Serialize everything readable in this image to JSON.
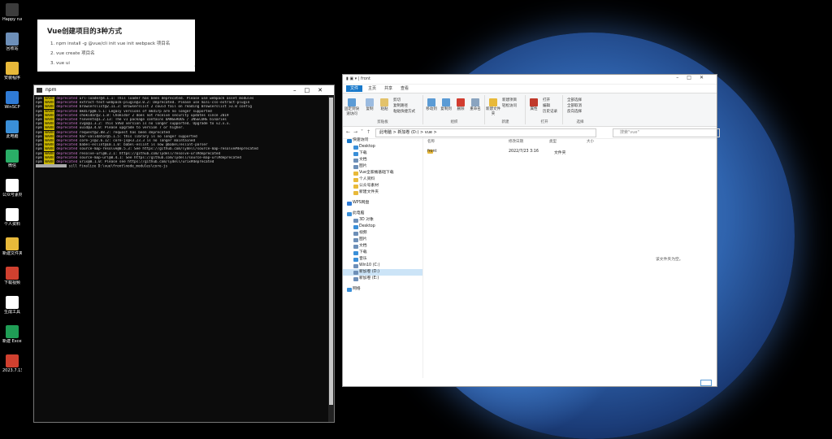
{
  "desktop": {
    "icons": [
      {
        "label": "Happy\nrunle...",
        "icon": "app-icon",
        "color": "#3c3c3c"
      },
      {
        "label": "回收站",
        "icon": "recycle-bin-icon",
        "color": "#6d8fb8"
      },
      {
        "label": "安装程序",
        "icon": "file-icon",
        "color": "#e8b93a"
      },
      {
        "label": "WinSCP",
        "icon": "winscp-icon",
        "color": "#2f7bd6"
      },
      {
        "label": "此电脑",
        "icon": "computer-icon",
        "color": "#3a8fd8"
      },
      {
        "label": "微信",
        "icon": "wechat-icon",
        "color": "#2aae67"
      },
      {
        "label": "公众号素材",
        "icon": "file-icon",
        "color": "#ffffff"
      },
      {
        "label": "个人资料",
        "icon": "file-icon",
        "color": "#ffffff"
      },
      {
        "label": "新建文件夹",
        "icon": "folder-icon",
        "color": "#e8b93a"
      },
      {
        "label": "下载视频",
        "icon": "pdf-icon",
        "color": "#d0402f"
      },
      {
        "label": "生成工具",
        "icon": "document-icon",
        "color": "#ffffff"
      },
      {
        "label": "新建 Excel",
        "icon": "excel-icon",
        "color": "#1f9d55"
      },
      {
        "label": "2023.7.13",
        "icon": "app-icon",
        "color": "#d0402f"
      }
    ]
  },
  "notes": {
    "title": "Vue创建项目的3种方式",
    "items": [
      "1. npm install -g @vue/cli init     vue init webpack 项目名",
      "2. vue create 项目名",
      "3. vue ui"
    ]
  },
  "terminal": {
    "title": "npm",
    "lines": [
      {
        "prefix": "npm",
        "level": "WARN",
        "kind": "deprecated",
        "text": "url-loader@4.1.1: This loader has been deprecated. Please use webpack asset modules"
      },
      {
        "prefix": "npm",
        "level": "WARN",
        "kind": "deprecated",
        "text": "extract-text-webpack-plugin@3.0.2: Deprecated. Please use mini-css-extract-plugin"
      },
      {
        "prefix": "npm",
        "level": "WARN",
        "kind": "deprecated",
        "text": "browserslist@2.11.3: Browserslist 2 could fail on reading Browserslist >3.0 config"
      },
      {
        "prefix": "npm",
        "level": "WARN",
        "kind": "deprecated",
        "text": "mkdirp@0.5.1: Legacy versions of mkdirp are no longer supported"
      },
      {
        "prefix": "npm",
        "level": "WARN",
        "kind": "deprecated",
        "text": "chokidar@2.1.8: Chokidar 2 does not receive security updates since 2019"
      },
      {
        "prefix": "npm",
        "level": "WARN",
        "kind": "deprecated",
        "text": "fsevents@1.2.13: The v1 package contains DANGEROUS / INSECURE binaries"
      },
      {
        "prefix": "npm",
        "level": "WARN",
        "kind": "deprecated",
        "text": "svgo@1.3.2: This SVGO version is no longer supported. Upgrade to v2.x.x."
      },
      {
        "prefix": "npm",
        "level": "WARN",
        "kind": "deprecated",
        "text": "uuid@3.4.0: Please upgrade to version 7 or higher."
      },
      {
        "prefix": "npm",
        "level": "WARN",
        "kind": "deprecated",
        "text": "request@2.88.2: request has been deprecated"
      },
      {
        "prefix": "npm",
        "level": "WARN",
        "kind": "deprecated",
        "text": "har-validator@5.1.5: this library is no longer supported"
      },
      {
        "prefix": "npm",
        "level": "WARN",
        "kind": "deprecated",
        "text": "core-js@2.6.12: core-js@<3.23.3 is no longer maintained"
      },
      {
        "prefix": "npm",
        "level": "WARN",
        "kind": "deprecated",
        "text": "babel-eslint@10.1.0: babel-eslint is now @babel/eslint-parser"
      },
      {
        "prefix": "npm",
        "level": "WARN",
        "kind": "deprecated",
        "text": "source-map-resolve@0.5.3: See https://github.com/lydell/source-map-resolve#deprecated"
      },
      {
        "prefix": "npm",
        "level": "WARN",
        "kind": "deprecated",
        "text": "resolve-url@0.2.1: https://github.com/lydell/resolve-url#deprecated"
      },
      {
        "prefix": "npm",
        "level": "WARN",
        "kind": "deprecated",
        "text": "source-map-url@0.4.1: See https://github.com/lydell/source-map-url#deprecated"
      },
      {
        "prefix": "npm",
        "level": "WARN",
        "kind": "deprecated",
        "text": "urix@0.1.0: Please see https://github.com/lydell/urix#deprecated"
      }
    ],
    "last_line": "sill finalize D:\\vue\\front\\node_modules\\core-js"
  },
  "explorer": {
    "title": "front",
    "tabs": [
      "文件",
      "主页",
      "共享",
      "查看"
    ],
    "ribbon": {
      "groups": [
        "剪贴板",
        "组织",
        "新建",
        "打开",
        "选择"
      ],
      "clipboard": [
        "固定到快速访问",
        "复制",
        "粘贴"
      ],
      "clipboard_small": [
        "剪切",
        "复制路径",
        "粘贴快捷方式"
      ],
      "organize": [
        "移动到",
        "复制到",
        "删除",
        "重命名"
      ],
      "new": [
        "新建文件夹"
      ],
      "new_small": [
        "新建项目",
        "轻松访问"
      ],
      "open": [
        "属性"
      ],
      "open_small": [
        "打开",
        "编辑",
        "历史记录"
      ],
      "select_small": [
        "全部选择",
        "全部取消",
        "反向选择"
      ]
    },
    "address": "此电脑 > 新加卷 (D:) > vue >",
    "search_placeholder": "搜索\"vue\"",
    "nav": [
      {
        "label": "快速访问",
        "level": 1,
        "color": "#1979ca"
      },
      {
        "label": "Desktop",
        "level": 2,
        "color": "#3a8fd8"
      },
      {
        "label": "下载",
        "level": 2,
        "color": "#3a8fd8"
      },
      {
        "label": "文档",
        "level": 2,
        "color": "#6d8fb8"
      },
      {
        "label": "图片",
        "level": 2,
        "color": "#6d8fb8"
      },
      {
        "label": "Vue全家桶基础下载",
        "level": 2,
        "color": "#e8b93a"
      },
      {
        "label": "个人资料",
        "level": 2,
        "color": "#e8b93a"
      },
      {
        "label": "公众号素材",
        "level": 2,
        "color": "#e8b93a"
      },
      {
        "label": "新建文件夹",
        "level": 2,
        "color": "#e8b93a"
      },
      {
        "label": "WPS网盘",
        "level": 1,
        "color": "#2f7bd6"
      },
      {
        "label": "此电脑",
        "level": 1,
        "color": "#3a8fd8"
      },
      {
        "label": "3D 对象",
        "level": 2,
        "color": "#6d8fb8"
      },
      {
        "label": "Desktop",
        "level": 2,
        "color": "#3a8fd8"
      },
      {
        "label": "视频",
        "level": 2,
        "color": "#6d8fb8"
      },
      {
        "label": "图片",
        "level": 2,
        "color": "#6d8fb8"
      },
      {
        "label": "文档",
        "level": 2,
        "color": "#6d8fb8"
      },
      {
        "label": "下载",
        "level": 2,
        "color": "#3a8fd8"
      },
      {
        "label": "音乐",
        "level": 2,
        "color": "#3a8fd8"
      },
      {
        "label": "Win10 (C:)",
        "level": 2,
        "color": "#6d8fb8"
      },
      {
        "label": "新加卷 (D:)",
        "level": 2,
        "color": "#6d8fb8",
        "selected": true
      },
      {
        "label": "新加卷 (E:)",
        "level": 2,
        "color": "#6d8fb8"
      },
      {
        "label": "网络",
        "level": 1,
        "color": "#3a8fd8"
      }
    ],
    "columns": [
      "名称",
      "修改日期",
      "类型",
      "大小"
    ],
    "files": [
      {
        "name": "front",
        "date": "2022/7/23 3:16",
        "type": "文件夹",
        "size": ""
      }
    ],
    "hint": "该文件夹为空。"
  }
}
